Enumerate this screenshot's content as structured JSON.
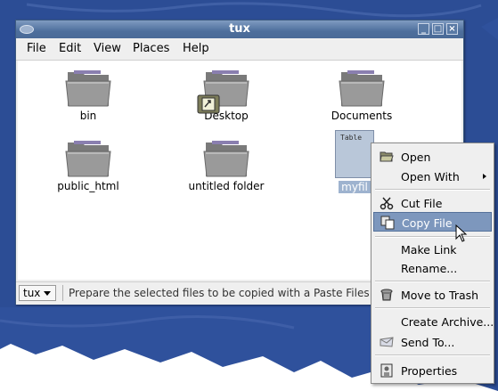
{
  "window": {
    "title": "tux"
  },
  "menubar": {
    "items": [
      "File",
      "Edit",
      "View",
      "Places",
      "Help"
    ]
  },
  "files": [
    {
      "name": "bin",
      "kind": "folder"
    },
    {
      "name": "Desktop",
      "kind": "folder"
    },
    {
      "name": "Documents",
      "kind": "folder"
    },
    {
      "name": "public_html",
      "kind": "folder"
    },
    {
      "name": "untitled folder",
      "kind": "folder"
    },
    {
      "name": "myfil",
      "kind": "document",
      "preview_text": "Table",
      "selected": true
    }
  ],
  "statusbar": {
    "location": "tux",
    "message": "Prepare the selected files to be copied with a Paste Files c"
  },
  "context_menu": {
    "items": [
      {
        "label": "Open",
        "icon": "folder-open-icon"
      },
      {
        "label": "Open With",
        "submenu": true
      },
      {
        "label": "Cut File",
        "icon": "scissors-icon"
      },
      {
        "label": "Copy File",
        "icon": "copy-icon",
        "highlighted": true
      },
      {
        "label": "Make Link"
      },
      {
        "label": "Rename..."
      },
      {
        "label": "Move to Trash",
        "icon": "trash-icon"
      },
      {
        "label": "Create Archive..."
      },
      {
        "label": "Send To...",
        "icon": "envelope-icon"
      },
      {
        "label": "Properties",
        "icon": "properties-icon"
      }
    ]
  },
  "colors": {
    "highlight": "#7d97bd",
    "titlebar": "#4e6f9c",
    "background_blue": "#2e4f9a"
  }
}
